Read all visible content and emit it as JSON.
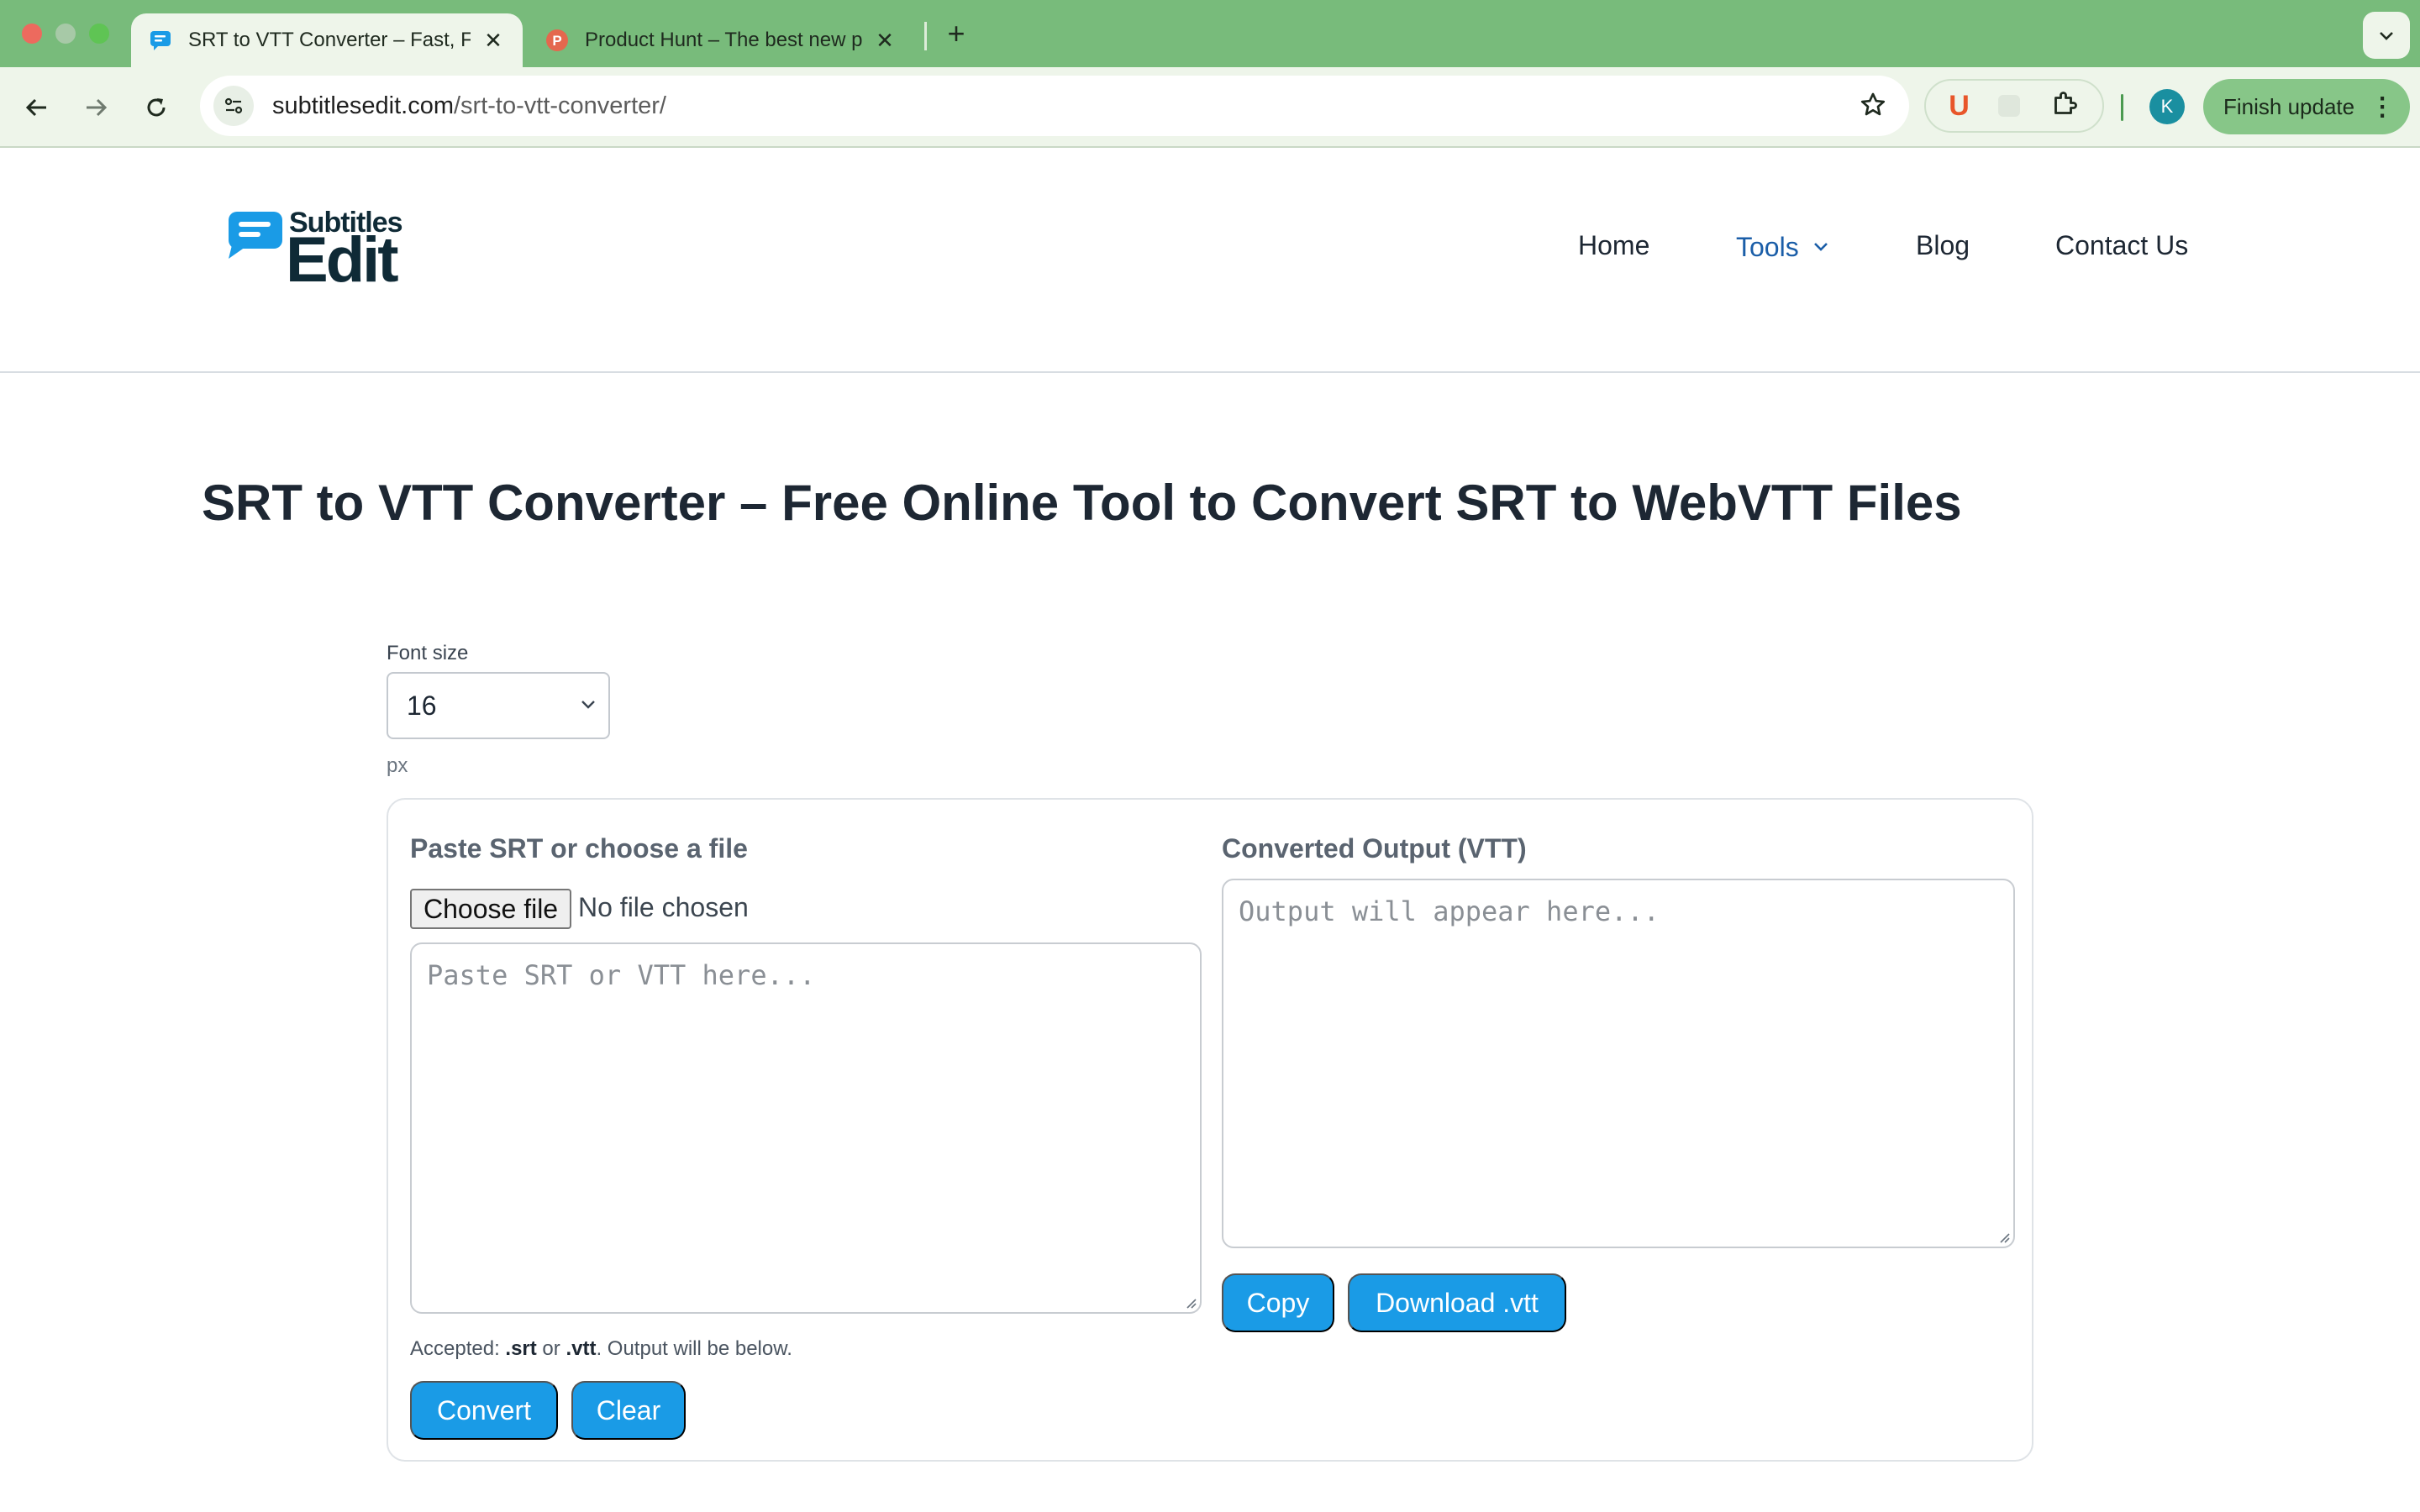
{
  "browser": {
    "tabs": [
      {
        "title": "SRT to VTT Converter – Fast, Free & Secure",
        "active": true
      },
      {
        "title": "Product Hunt – The best new products in tech",
        "active": false
      }
    ],
    "new_tab_symbol": "+",
    "url_domain": "subtitlesedit.com",
    "url_path": "/srt-to-vtt-converter/",
    "extension_letter": "U",
    "profile_initial": "K",
    "finish_update_label": "Finish update",
    "accent_color": "#78bb7b"
  },
  "site": {
    "logo_top": "Subtitles",
    "logo_bottom": "Edit",
    "nav": {
      "home": "Home",
      "tools": "Tools",
      "blog": "Blog",
      "contact": "Contact Us"
    },
    "brand_color": "#1a9be6"
  },
  "main": {
    "title": "SRT to VTT Converter – Free Online Tool to Convert SRT to WebVTT Files",
    "font_size": {
      "label": "Font size",
      "value": "16",
      "unit": "px"
    },
    "input_panel": {
      "heading": "Paste SRT or choose a file",
      "choose_file_label": "Choose file",
      "file_status": "No file chosen",
      "placeholder": "Paste SRT or VTT here...",
      "accepted_prefix": "Accepted: ",
      "accepted_ext1": ".srt",
      "accepted_or": " or ",
      "accepted_ext2": ".vtt",
      "accepted_suffix": ". Output will be below.",
      "convert_label": "Convert",
      "clear_label": "Clear"
    },
    "output_panel": {
      "heading": "Converted Output (VTT)",
      "placeholder": "Output will appear here...",
      "copy_label": "Copy",
      "download_label": "Download .vtt"
    }
  }
}
